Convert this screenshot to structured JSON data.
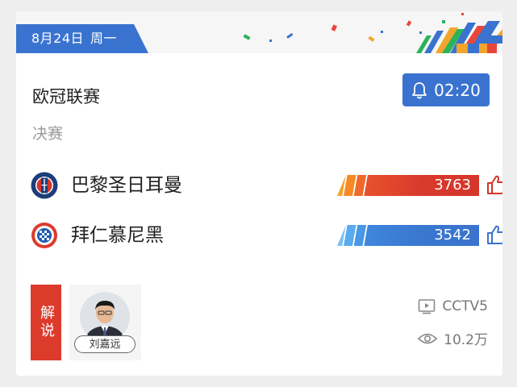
{
  "header": {
    "date": "8月24日",
    "weekday": "周一"
  },
  "match": {
    "competition": "欧冠联赛",
    "stage": "决赛",
    "countdown": "02:20"
  },
  "teams": [
    {
      "name": "巴黎圣日耳曼",
      "votes": "3763",
      "logo_icon": "psg-logo-icon",
      "color": "#d5352b"
    },
    {
      "name": "拜仁慕尼黑",
      "votes": "3542",
      "logo_icon": "bayern-logo-icon",
      "color": "#3a73cf"
    }
  ],
  "commentary": {
    "tag_label": "解说",
    "commentator_name": "刘嘉远"
  },
  "broadcast": {
    "channel": "CCTV5",
    "views": "10.2万"
  },
  "colors": {
    "accent_blue": "#3a73cf",
    "accent_red": "#dc3b2c"
  }
}
